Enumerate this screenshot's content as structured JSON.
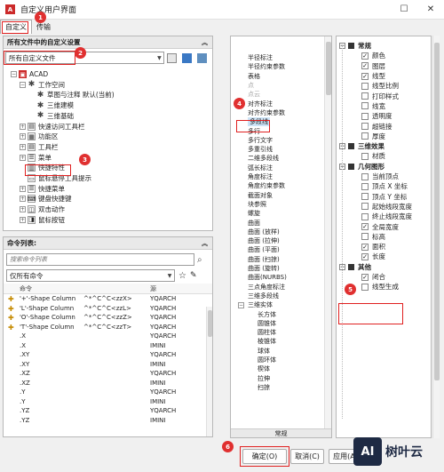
{
  "window": {
    "title": "自定义用户界面",
    "close_glyph": "✕",
    "max_glyph": "☐"
  },
  "tabs": [
    "自定义",
    "传输"
  ],
  "left_top": {
    "header": "所有文件中的自定义设置",
    "combo_value": "所有自定义文件",
    "tree": [
      {
        "label": "ACAD",
        "indent": 0,
        "icon": "acad-icon",
        "pm": "−"
      },
      {
        "label": "工作空间",
        "indent": 1,
        "icon": "gear-icon",
        "pm": "−"
      },
      {
        "label": "草图与注释 默认(当前)",
        "indent": 2,
        "icon": "gear-icon",
        "pm": ""
      },
      {
        "label": "三维建模",
        "indent": 2,
        "icon": "gear-icon",
        "pm": ""
      },
      {
        "label": "三维基础",
        "indent": 2,
        "icon": "gear-icon",
        "pm": ""
      },
      {
        "label": "快速访问工具栏",
        "indent": 1,
        "icon": "toolbar-icon",
        "pm": "+"
      },
      {
        "label": "功能区",
        "indent": 1,
        "icon": "ribbon-icon",
        "pm": "+"
      },
      {
        "label": "工具栏",
        "indent": 1,
        "icon": "toolbar-icon",
        "pm": "+"
      },
      {
        "label": "菜单",
        "indent": 1,
        "icon": "menu-icon",
        "pm": "+"
      },
      {
        "label": "快捷特性",
        "indent": 1,
        "icon": "quick-properties-icon",
        "pm": ""
      },
      {
        "label": "鼠标悬停工具提示",
        "indent": 1,
        "icon": "tooltip-icon",
        "pm": ""
      },
      {
        "label": "快捷菜单",
        "indent": 1,
        "icon": "menu-icon",
        "pm": "+"
      },
      {
        "label": "键盘快捷键",
        "indent": 1,
        "icon": "keyboard-icon",
        "pm": "+"
      },
      {
        "label": "双击动作",
        "indent": 1,
        "icon": "double-click-icon",
        "pm": "+"
      },
      {
        "label": "鼠标按钮",
        "indent": 1,
        "icon": "mouse-icon",
        "pm": "+"
      }
    ]
  },
  "left_bottom": {
    "header": "命令列表:",
    "search_placeholder": "搜索命令列表",
    "filter_value": "仅所有命令",
    "columns": [
      "命令",
      "",
      "源"
    ],
    "rows": [
      {
        "cmd": "'+'-Shape Column",
        "macro": "^*^C^C<zzX>",
        "src": "YQARCH",
        "icon": true
      },
      {
        "cmd": "'L'-Shape Column",
        "macro": "^*^C^C<zzL>",
        "src": "YQARCH",
        "icon": true
      },
      {
        "cmd": "'O'-Shape Column",
        "macro": "^*^C^C<zzZ>",
        "src": "YQARCH",
        "icon": true
      },
      {
        "cmd": "'T'-Shape Column",
        "macro": "^*^C^C<zzT>",
        "src": "YQARCH",
        "icon": true
      },
      {
        "cmd": ".X",
        "macro": "",
        "src": "YQARCH",
        "icon": false
      },
      {
        "cmd": ".X",
        "macro": "",
        "src": "IMINI",
        "icon": false
      },
      {
        "cmd": ".XY",
        "macro": "",
        "src": "YQARCH",
        "icon": false
      },
      {
        "cmd": ".XY",
        "macro": "",
        "src": "IMINI",
        "icon": false
      },
      {
        "cmd": ".XZ",
        "macro": "",
        "src": "YQARCH",
        "icon": false
      },
      {
        "cmd": ".XZ",
        "macro": "",
        "src": "IMINI",
        "icon": false
      },
      {
        "cmd": ".Y",
        "macro": "",
        "src": "YQARCH",
        "icon": false
      },
      {
        "cmd": ".Y",
        "macro": "",
        "src": "IMINI",
        "icon": false
      },
      {
        "cmd": ".YZ",
        "macro": "",
        "src": "YQARCH",
        "icon": false
      },
      {
        "cmd": ".YZ",
        "macro": "",
        "src": "IMINI",
        "icon": false
      }
    ]
  },
  "middle_list": {
    "items": [
      {
        "label": "半径标注",
        "gray": false,
        "indent": 0
      },
      {
        "label": "半径约束参数",
        "gray": false,
        "indent": 0
      },
      {
        "label": "表格",
        "gray": false,
        "indent": 0
      },
      {
        "label": "点",
        "gray": true,
        "indent": 0
      },
      {
        "label": "点云",
        "gray": true,
        "indent": 0
      },
      {
        "label": "对齐标注",
        "gray": false,
        "indent": 0
      },
      {
        "label": "对齐约束参数",
        "gray": false,
        "indent": 0
      },
      {
        "label": "多段线",
        "gray": false,
        "indent": 0,
        "selected": true
      },
      {
        "label": "多行",
        "gray": false,
        "indent": 0
      },
      {
        "label": "多行文字",
        "gray": false,
        "indent": 0
      },
      {
        "label": "多重引线",
        "gray": false,
        "indent": 0
      },
      {
        "label": "二维多段线",
        "gray": false,
        "indent": 0
      },
      {
        "label": "弧长标注",
        "gray": false,
        "indent": 0
      },
      {
        "label": "角度标注",
        "gray": false,
        "indent": 0
      },
      {
        "label": "角度约束参数",
        "gray": false,
        "indent": 0
      },
      {
        "label": "截面对象",
        "gray": false,
        "indent": 0
      },
      {
        "label": "块参照",
        "gray": false,
        "indent": 0
      },
      {
        "label": "螺旋",
        "gray": false,
        "indent": 0
      },
      {
        "label": "曲面",
        "gray": false,
        "indent": 0
      },
      {
        "label": "曲面 (放样)",
        "gray": false,
        "indent": 0
      },
      {
        "label": "曲面 (拉伸)",
        "gray": false,
        "indent": 0
      },
      {
        "label": "曲面 (平面)",
        "gray": false,
        "indent": 0
      },
      {
        "label": "曲面 (扫掠)",
        "gray": false,
        "indent": 0
      },
      {
        "label": "曲面 (旋转)",
        "gray": false,
        "indent": 0
      },
      {
        "label": "曲面(NURBS)",
        "gray": false,
        "indent": 0
      },
      {
        "label": "三点角度标注",
        "gray": false,
        "indent": 0
      },
      {
        "label": "三维多段线",
        "gray": false,
        "indent": 0
      },
      {
        "label": "三维实体",
        "gray": false,
        "indent": 0,
        "pm": "−"
      },
      {
        "label": "长方体",
        "gray": false,
        "indent": 1
      },
      {
        "label": "圆锥体",
        "gray": false,
        "indent": 1
      },
      {
        "label": "圆柱体",
        "gray": false,
        "indent": 1
      },
      {
        "label": "棱锥体",
        "gray": false,
        "indent": 1
      },
      {
        "label": "球体",
        "gray": false,
        "indent": 1
      },
      {
        "label": "圆环体",
        "gray": false,
        "indent": 1
      },
      {
        "label": "楔体",
        "gray": false,
        "indent": 1
      },
      {
        "label": "拉伸",
        "gray": false,
        "indent": 1
      },
      {
        "label": "扫掠",
        "gray": false,
        "indent": 1
      }
    ],
    "footer_label": "常规"
  },
  "properties": {
    "rows": [
      {
        "type": "section",
        "label": "常规"
      },
      {
        "type": "item",
        "label": "颜色",
        "checked": true
      },
      {
        "type": "item",
        "label": "图层",
        "checked": true
      },
      {
        "type": "item",
        "label": "线型",
        "checked": true
      },
      {
        "type": "item",
        "label": "线型比例",
        "checked": false
      },
      {
        "type": "item",
        "label": "打印样式",
        "checked": false
      },
      {
        "type": "item",
        "label": "线宽",
        "checked": false
      },
      {
        "type": "item",
        "label": "透明度",
        "checked": false
      },
      {
        "type": "item",
        "label": "超链接",
        "checked": false
      },
      {
        "type": "item",
        "label": "厚度",
        "checked": false
      },
      {
        "type": "section",
        "label": "三维效果"
      },
      {
        "type": "item",
        "label": "材质",
        "checked": false
      },
      {
        "type": "section",
        "label": "几何图形"
      },
      {
        "type": "item",
        "label": "当前顶点",
        "checked": false
      },
      {
        "type": "item",
        "label": "顶点 X 坐标",
        "checked": false
      },
      {
        "type": "item",
        "label": "顶点 Y 坐标",
        "checked": false
      },
      {
        "type": "item",
        "label": "起始线段宽度",
        "checked": false
      },
      {
        "type": "item",
        "label": "终止线段宽度",
        "checked": false
      },
      {
        "type": "item",
        "label": "全局宽度",
        "checked": true
      },
      {
        "type": "item",
        "label": "标高",
        "checked": false
      },
      {
        "type": "item",
        "label": "面积",
        "checked": true
      },
      {
        "type": "item",
        "label": "长度",
        "checked": true
      },
      {
        "type": "section",
        "label": "其他"
      },
      {
        "type": "item",
        "label": "闭合",
        "checked": true
      },
      {
        "type": "item",
        "label": "线型生成",
        "checked": false
      }
    ]
  },
  "buttons": {
    "ok": "确定(O)",
    "cancel": "取消(C)",
    "apply": "应用(A)"
  },
  "annotations": [
    "1",
    "2",
    "3",
    "4",
    "5",
    "6"
  ],
  "watermark": "树叶云",
  "watermark_logo": "AI"
}
